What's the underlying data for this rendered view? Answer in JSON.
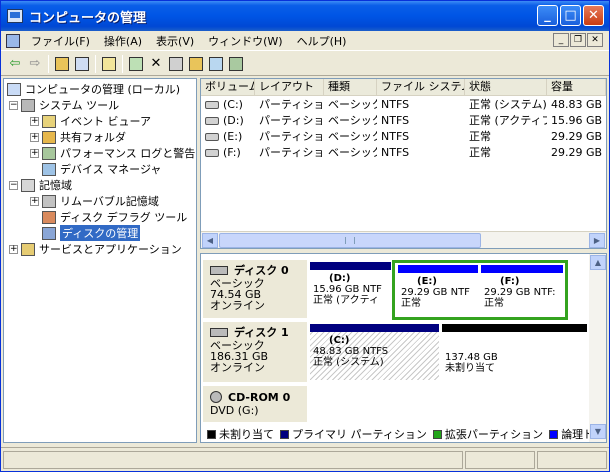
{
  "window": {
    "title": "コンピュータの管理"
  },
  "menu": [
    "ファイル(F)",
    "操作(A)",
    "表示(V)",
    "ウィンドウ(W)",
    "ヘルプ(H)"
  ],
  "tree": [
    {
      "label": "コンピュータの管理 (ローカル)",
      "expander": "",
      "icon": "computer-icon",
      "level": 0
    },
    {
      "label": "システム ツール",
      "expander": "−",
      "icon": "tools-icon",
      "level": 1
    },
    {
      "label": "イベント ビューア",
      "expander": "+",
      "icon": "event-viewer-icon",
      "level": 2
    },
    {
      "label": "共有フォルダ",
      "expander": "+",
      "icon": "shared-folder-icon",
      "level": 2
    },
    {
      "label": "パフォーマンス ログと警告",
      "expander": "+",
      "icon": "performance-icon",
      "level": 2
    },
    {
      "label": "デバイス マネージャ",
      "expander": "",
      "icon": "device-manager-icon",
      "level": 2
    },
    {
      "label": "記憶域",
      "expander": "−",
      "icon": "storage-icon",
      "level": 1
    },
    {
      "label": "リムーバブル記憶域",
      "expander": "+",
      "icon": "removable-storage-icon",
      "level": 2
    },
    {
      "label": "ディスク デフラグ ツール",
      "expander": "",
      "icon": "defrag-icon",
      "level": 2
    },
    {
      "label": "ディスクの管理",
      "expander": "",
      "icon": "disk-management-icon",
      "level": 2,
      "selected": true
    },
    {
      "label": "サービスとアプリケーション",
      "expander": "+",
      "icon": "services-icon",
      "level": 1
    }
  ],
  "columns": [
    "ボリューム",
    "レイアウト",
    "種類",
    "ファイル システム",
    "状態",
    "容量"
  ],
  "volumes": [
    [
      "(C:)",
      "パーティション",
      "ベーシック",
      "NTFS",
      "正常 (システム)",
      "48.83 GB"
    ],
    [
      "(D:)",
      "パーティション",
      "ベーシック",
      "NTFS",
      "正常 (アクティブ)",
      "15.96 GB"
    ],
    [
      "(E:)",
      "パーティション",
      "ベーシック",
      "NTFS",
      "正常",
      "29.29 GB"
    ],
    [
      "(F:)",
      "パーティション",
      "ベーシック",
      "NTFS",
      "正常",
      "29.29 GB"
    ]
  ],
  "disks": [
    {
      "name": "ディスク 0",
      "type": "ベーシック",
      "size": "74.54 GB",
      "status": "オンライン",
      "partitions": [
        {
          "name": "(D:)",
          "line1": "15.96 GB NTF",
          "line2": "正常 (アクティ"
        },
        {
          "name": "(E:)",
          "line1": "29.29 GB NTF",
          "line2": "正常"
        },
        {
          "name": "(F:)",
          "line1": "29.29 GB NTF:",
          "line2": "正常"
        }
      ]
    },
    {
      "name": "ディスク 1",
      "type": "ベーシック",
      "size": "186.31 GB",
      "status": "オンライン",
      "partitions": [
        {
          "name": "(C:)",
          "line1": "48.83 GB NTFS",
          "line2": "正常 (システム)"
        },
        {
          "name": "",
          "line1": "137.48 GB",
          "line2": "未割り当て"
        }
      ]
    },
    {
      "name": "CD-ROM 0",
      "type": "DVD (G:)",
      "size": "",
      "status": ""
    }
  ],
  "legend": [
    {
      "label": "未割り当て",
      "color": "#000000"
    },
    {
      "label": "プライマリ パーティション",
      "color": "#00007f"
    },
    {
      "label": "拡張パーティション",
      "color": "#23a51a"
    },
    {
      "label": "論理ドライブ",
      "color": "#0000ff"
    }
  ],
  "colors": {
    "primary": "#00007f",
    "logical": "#0000ff",
    "extended": "#34a31f",
    "unallocated": "#000000"
  }
}
